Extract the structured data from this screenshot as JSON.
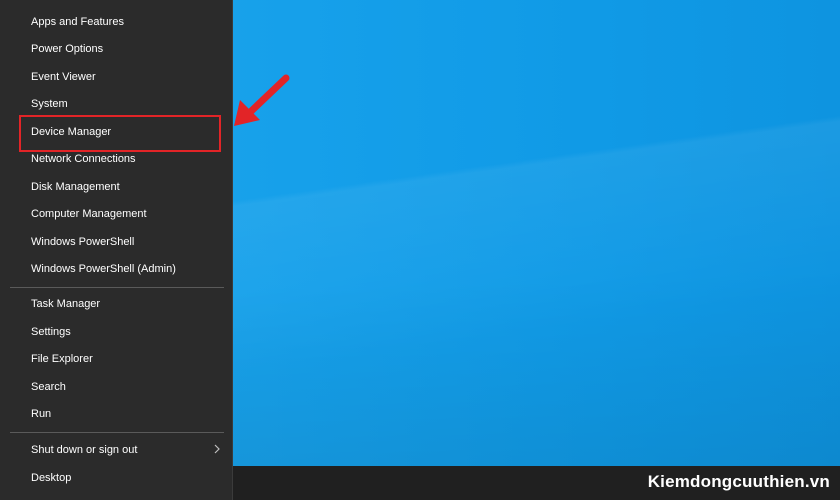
{
  "menu": {
    "items_group1": [
      {
        "label": "Apps and Features"
      },
      {
        "label": "Power Options"
      },
      {
        "label": "Event Viewer"
      },
      {
        "label": "System"
      },
      {
        "label": "Device Manager"
      },
      {
        "label": "Network Connections"
      },
      {
        "label": "Disk Management"
      },
      {
        "label": "Computer Management"
      },
      {
        "label": "Windows PowerShell"
      },
      {
        "label": "Windows PowerShell (Admin)"
      }
    ],
    "items_group2": [
      {
        "label": "Task Manager"
      },
      {
        "label": "Settings"
      },
      {
        "label": "File Explorer"
      },
      {
        "label": "Search"
      },
      {
        "label": "Run"
      }
    ],
    "items_group3": [
      {
        "label": "Shut down or sign out",
        "has_submenu": true
      },
      {
        "label": "Desktop"
      }
    ]
  },
  "annotations": {
    "highlight_target": "Device Manager",
    "highlight_color": "#e22427",
    "arrow_color": "#e22427"
  },
  "watermark": "Kiemdongcuuthien.vn",
  "colors": {
    "menu_bg": "#2b2b2b",
    "desktop_bg": "#16a0ea",
    "taskbar_bg": "#202020"
  },
  "icons": [
    "chevron-right-icon",
    "red-arrow-icon"
  ]
}
